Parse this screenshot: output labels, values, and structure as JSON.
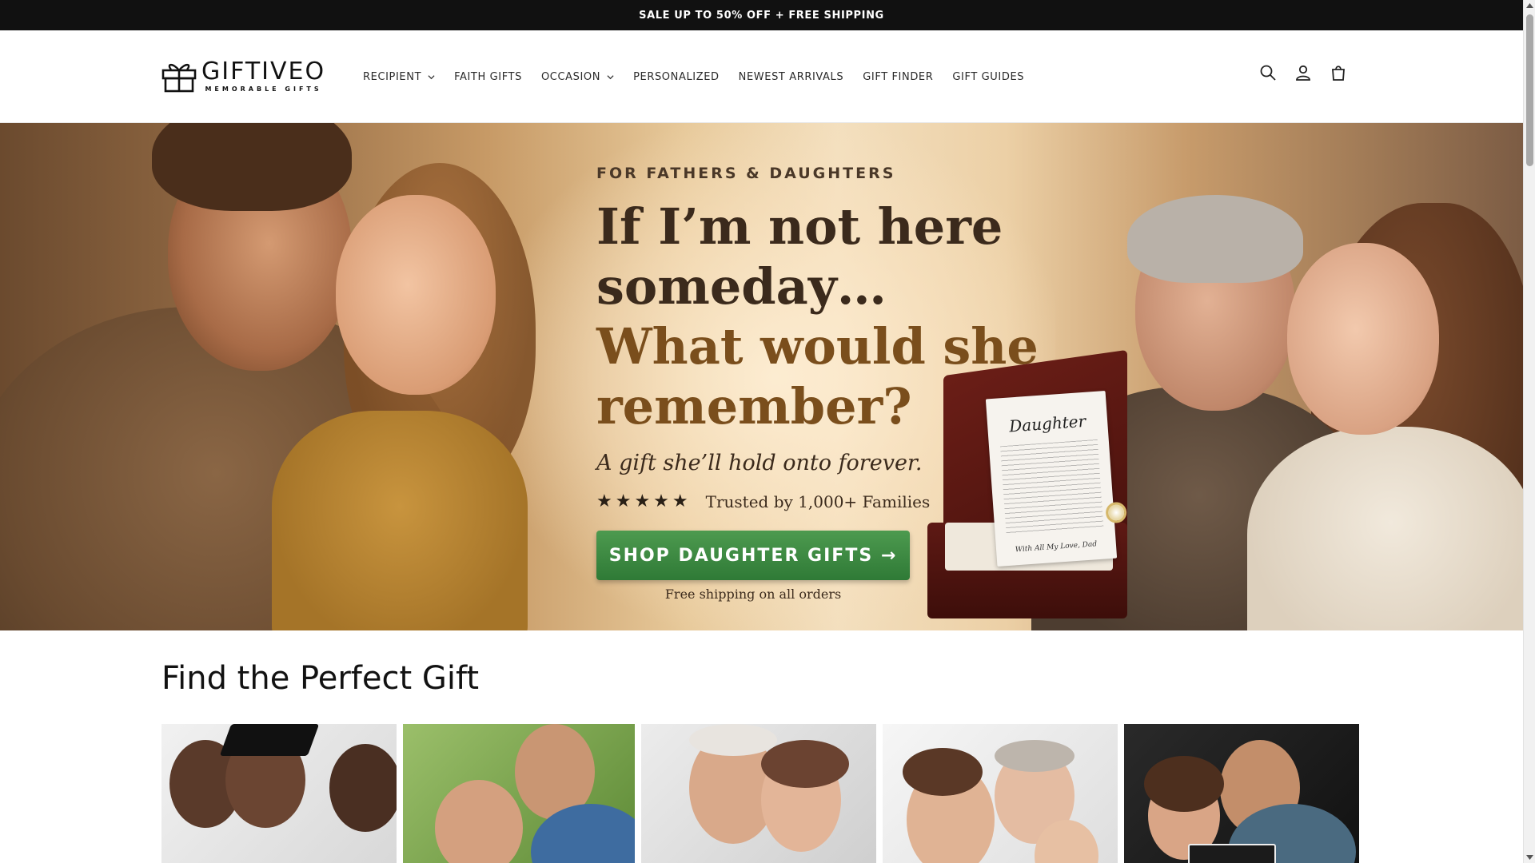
{
  "announcement": {
    "text": "SALE UP TO 50% OFF + FREE SHIPPING"
  },
  "brand": {
    "name": "GIFTIVEO",
    "tagline": "MEMORABLE GIFTS"
  },
  "nav": {
    "items": [
      {
        "label": "RECIPIENT",
        "dropdown": true
      },
      {
        "label": "FAITH GIFTS",
        "dropdown": false
      },
      {
        "label": "OCCASION",
        "dropdown": true
      },
      {
        "label": "PERSONALIZED",
        "dropdown": false
      },
      {
        "label": "NEWEST ARRIVALS",
        "dropdown": false
      },
      {
        "label": "GIFT FINDER",
        "dropdown": false
      },
      {
        "label": "GIFT GUIDES",
        "dropdown": false
      }
    ]
  },
  "header_icons": [
    "search-icon",
    "account-icon",
    "cart-icon"
  ],
  "hero": {
    "eyebrow": "FOR FATHERS & DAUGHTERS",
    "headline_line1": "If I’m not here",
    "headline_line2": "someday…",
    "headline_line3": "What would she",
    "headline_line4": "remember?",
    "subline": "A gift she’ll hold onto forever.",
    "rating_stars": "★★★★★",
    "trust_text": "Trusted by 1,000+ Families",
    "cta_label": "SHOP DAUGHTER GIFTS →",
    "cta_note": "Free shipping on all orders",
    "card_title": "Daughter",
    "card_sign": "With All My Love, Dad"
  },
  "section": {
    "title": "Find the Perfect Gift",
    "tiles": [
      "graduation",
      "father-daughter-hug",
      "grandpa-granddaughter",
      "grandma-mom-child",
      "dad-daughter-sign"
    ]
  },
  "colors": {
    "announcement_bg": "#111111",
    "cta_green": "#3f8b43",
    "headline_brown": "#3b2a1c",
    "headline_accent": "#7a4e1c"
  }
}
